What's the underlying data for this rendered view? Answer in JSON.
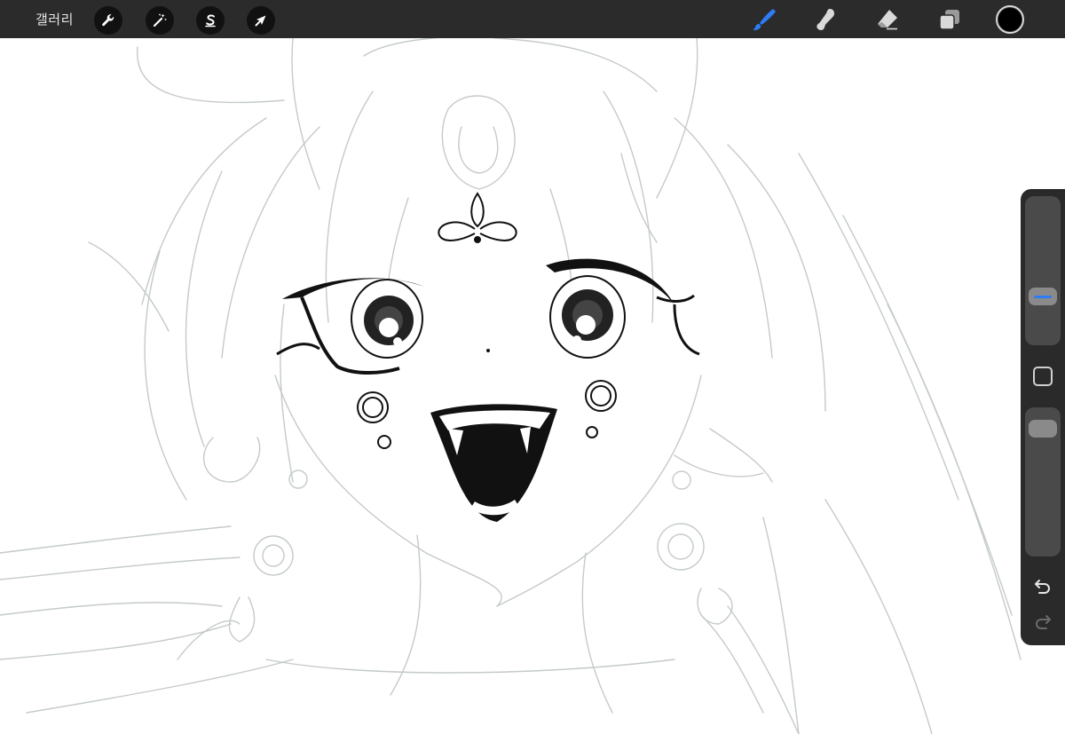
{
  "toolbar": {
    "gallery_label": "갤러리",
    "left_tools": [
      {
        "name": "actions",
        "icon": "wrench-icon"
      },
      {
        "name": "adjustments",
        "icon": "magic-wand-icon"
      },
      {
        "name": "selection",
        "icon": "selection-s-icon"
      },
      {
        "name": "transform",
        "icon": "arrow-cursor-icon"
      }
    ],
    "right_tools": [
      {
        "name": "brush",
        "icon": "brush-icon",
        "active": true
      },
      {
        "name": "smudge",
        "icon": "smudge-finger-icon",
        "active": false
      },
      {
        "name": "eraser",
        "icon": "eraser-icon",
        "active": false
      },
      {
        "name": "layers",
        "icon": "layers-icon",
        "active": false
      }
    ],
    "current_color": "#000000",
    "accent_color": "#2d7cf6"
  },
  "sidebar": {
    "brush_size_level": 0.29,
    "opacity_level": 0.93,
    "modify_icon": "square-icon",
    "undo_icon": "undo-icon",
    "redo_icon": "redo-icon"
  },
  "canvas": {
    "artwork": "sketch-illustration"
  }
}
